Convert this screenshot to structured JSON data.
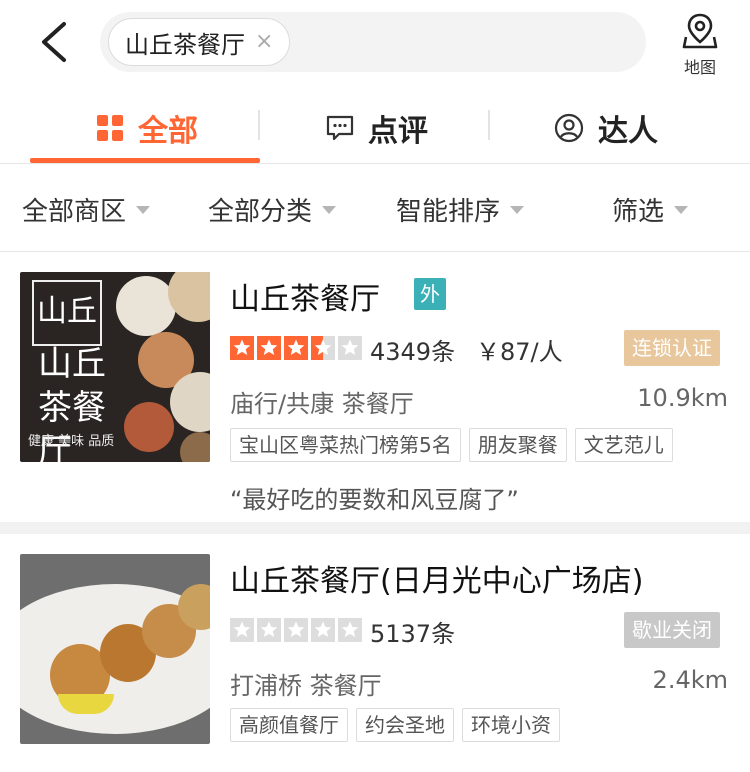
{
  "header": {
    "search_chip": "山丘茶餐厅",
    "chip_close": "×",
    "map_label": "地图"
  },
  "tabs": [
    {
      "label": "全部",
      "icon": "grid-icon",
      "active": true
    },
    {
      "label": "点评",
      "icon": "comment-icon",
      "active": false
    },
    {
      "label": "达人",
      "icon": "user-icon",
      "active": false
    }
  ],
  "filters": [
    "全部商区",
    "全部分类",
    "智能排序",
    "筛选"
  ],
  "results": [
    {
      "name": "山丘茶餐厅",
      "takeout_badge": "外",
      "rating": 3.5,
      "reviews": "4349条",
      "price": "￥87/人",
      "status": "连锁认证",
      "area_category": "庙行/共康  茶餐厅",
      "distance": "10.9km",
      "tags": [
        "宝山区粤菜热门榜第5名",
        "朋友聚餐",
        "文艺范儿"
      ],
      "quote": "“最好吃的要数和风豆腐了”",
      "thumb_text": {
        "logo": "山丘",
        "title": "山丘茶餐厅",
        "slogan": "健康 美味 品质"
      }
    },
    {
      "name": "山丘茶餐厅(日月光中心广场店)",
      "rating": 0,
      "reviews": "5137条",
      "status": "歇业关闭",
      "area_category": "打浦桥  茶餐厅",
      "distance": "2.4km",
      "tags": [
        "高颜值餐厅",
        "约会圣地",
        "环境小资"
      ]
    }
  ],
  "colors": {
    "accent": "#ff6633",
    "star_fill": "#ff6633",
    "star_empty": "#dddddd",
    "takeout_badge": "#3bb0b6",
    "chain_badge": "#e8c79d",
    "closed_badge": "#c8c8c8"
  }
}
